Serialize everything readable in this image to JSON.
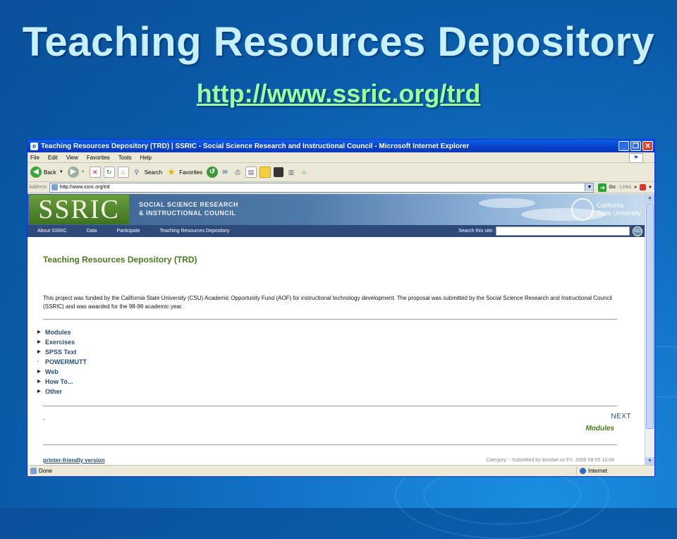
{
  "slide": {
    "title": "Teaching Resources Depository",
    "url": "http://www.ssric.org/trd"
  },
  "browser": {
    "window_title": "Teaching Resources Depository (TRD) | SSRIC - Social Science Research and Instructional Council - Microsoft Internet Explorer",
    "menu": [
      "File",
      "Edit",
      "View",
      "Favorites",
      "Tools",
      "Help"
    ],
    "toolbar": {
      "back": "Back",
      "search": "Search",
      "favorites": "Favorites"
    },
    "address_label": "Address",
    "address_value": "http://www.ssric.org/trd",
    "go_label": "Go",
    "links_label": "Links",
    "status_text": "Done",
    "zone_text": "Internet"
  },
  "site": {
    "logo": "SSRIC",
    "org_line1": "SOCIAL SCIENCE RESEARCH",
    "org_line2": "& INSTRUCTIONAL COUNCIL",
    "csu_line1": "California",
    "csu_line2": "State University",
    "nav": [
      "About SSRIC",
      "Data",
      "Participate",
      "Teaching Resources Depository"
    ],
    "search_label": "Search this site:",
    "search_go": "GO",
    "page_heading": "Teaching Resources Depository (TRD)",
    "intro": "This project was funded by the California State University (CSU) Academic Opportunity Fund (AOF) for instructional technology development. The proposal was submitted by the Social Science Research and Instructional Council (SSRIC) and was awarded for the 98-98 academic year.",
    "links": [
      "Modules",
      "Exercises",
      "SPSS Text",
      "POWERMUTT",
      "Web",
      "How To...",
      "Other"
    ],
    "dash": "-",
    "next_label": "NEXT",
    "next_target": "Modules",
    "printer_link": "printer-friendly version",
    "meta": "Category: - Submitted by dombet on Fri, 2005-08-05 16:04"
  }
}
